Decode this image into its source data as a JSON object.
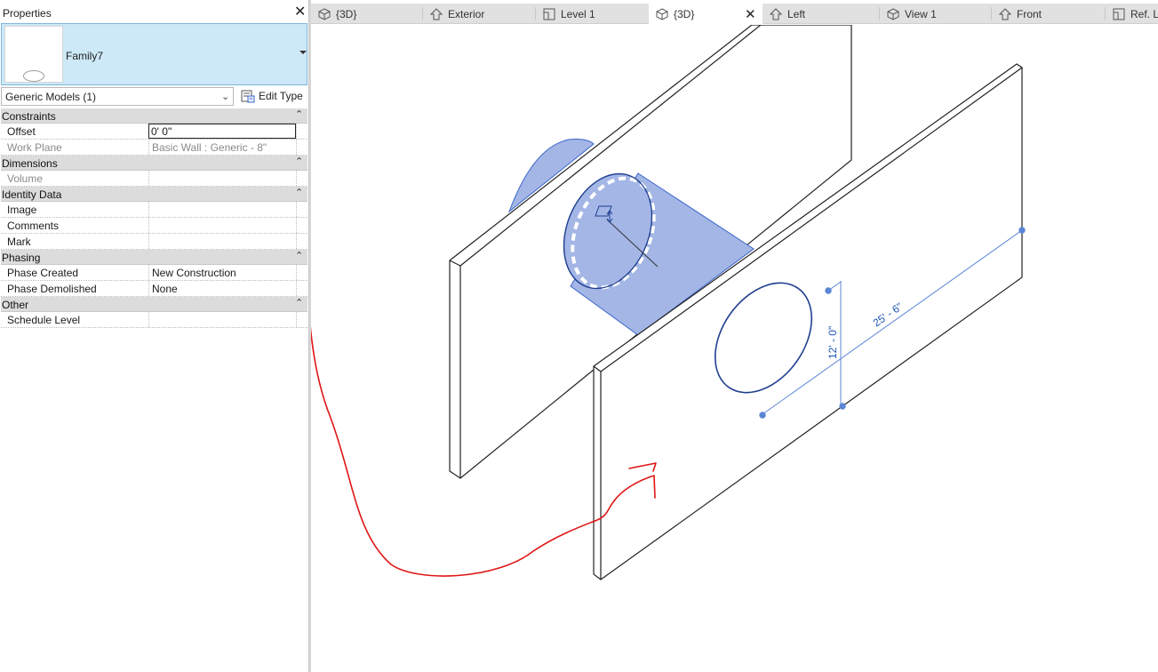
{
  "properties": {
    "title": "Properties",
    "close_glyph": "✕",
    "type_selector": {
      "name": "Family7",
      "thumbnail_icon": "ellipse-thumbnail-icon"
    },
    "category": "Generic Models (1)",
    "edit_type_label": "Edit Type",
    "groups": [
      {
        "label": "Constraints",
        "collapse_glyph": "⌃",
        "rows": [
          {
            "name": "Offset",
            "value": "0'  0\"",
            "editing": true,
            "disabled": false
          },
          {
            "name": "Work Plane",
            "value": "Basic Wall : Generic - 8\"",
            "disabled": true
          }
        ]
      },
      {
        "label": "Dimensions",
        "collapse_glyph": "⌃",
        "rows": [
          {
            "name": "Volume",
            "value": "",
            "disabled": true
          }
        ]
      },
      {
        "label": "Identity Data",
        "collapse_glyph": "⌃",
        "rows": [
          {
            "name": "Image",
            "value": ""
          },
          {
            "name": "Comments",
            "value": ""
          },
          {
            "name": "Mark",
            "value": ""
          }
        ]
      },
      {
        "label": "Phasing",
        "collapse_glyph": "⌃",
        "rows": [
          {
            "name": "Phase Created",
            "value": "New Construction"
          },
          {
            "name": "Phase Demolished",
            "value": "None"
          }
        ]
      },
      {
        "label": "Other",
        "collapse_glyph": "⌃",
        "rows": [
          {
            "name": "Schedule Level",
            "value": ""
          }
        ]
      }
    ]
  },
  "tabs": [
    {
      "label": "{3D}",
      "icon": "3d-view-icon",
      "active": false
    },
    {
      "label": "Exterior",
      "icon": "elevation-view-icon",
      "active": false
    },
    {
      "label": "Level 1",
      "icon": "floor-plan-icon",
      "active": false
    },
    {
      "label": "{3D}",
      "icon": "3d-view-icon",
      "active": true,
      "close_glyph": "✕"
    },
    {
      "label": "Left",
      "icon": "elevation-view-icon",
      "active": false
    },
    {
      "label": "View 1",
      "icon": "3d-view-icon",
      "active": false
    },
    {
      "label": "Front",
      "icon": "elevation-view-icon",
      "active": false
    },
    {
      "label": "Ref. L",
      "icon": "floor-plan-icon",
      "active": false
    }
  ],
  "viewport": {
    "dimensions": {
      "vertical": "12' - 0\"",
      "horizontal": "25' - 6\""
    },
    "colors": {
      "cylinder_fill": "#a3b6e6",
      "selection_blue": "#3a64c8",
      "dimension_blue": "#1f55b5",
      "annotation_red": "#e01515",
      "wall_edge": "#222222"
    }
  }
}
